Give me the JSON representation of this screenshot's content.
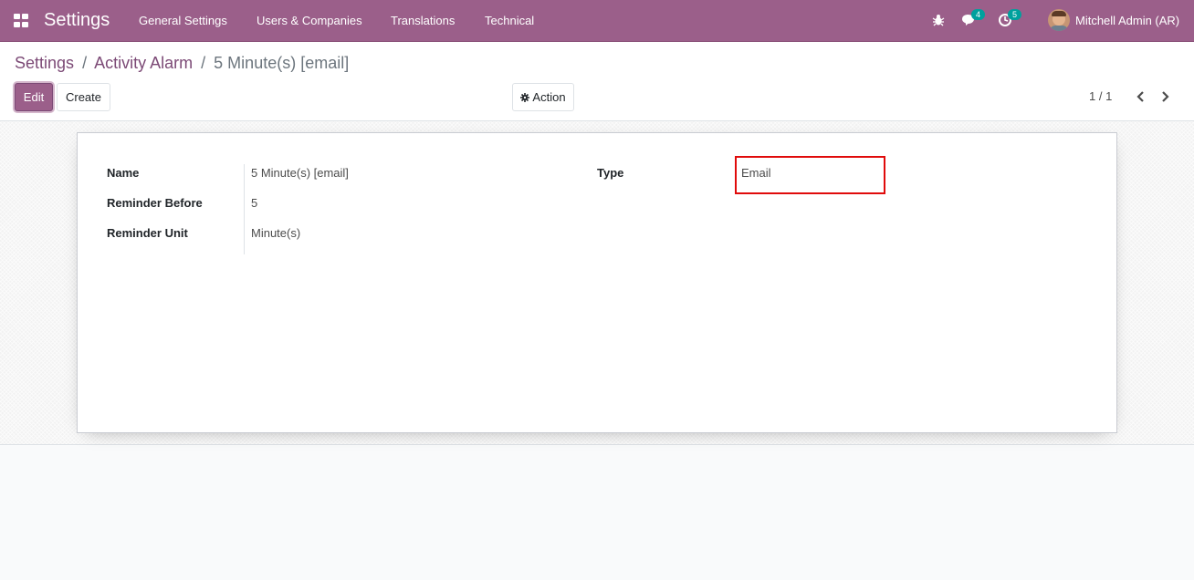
{
  "navbar": {
    "brand": "Settings",
    "menu": [
      "General Settings",
      "Users & Companies",
      "Translations",
      "Technical"
    ],
    "chat_count": "4",
    "activity_count": "5",
    "user_name": "Mitchell Admin (AR)"
  },
  "breadcrumb": {
    "level1": "Settings",
    "level2": "Activity Alarm",
    "current": "5 Minute(s) [email]",
    "separator": "/"
  },
  "buttons": {
    "edit": "Edit",
    "create": "Create",
    "action": "Action"
  },
  "pager": {
    "value": "1 / 1"
  },
  "form": {
    "name_label": "Name",
    "name_value": "5 Minute(s) [email]",
    "reminder_before_label": "Reminder Before",
    "reminder_before_value": "5",
    "reminder_unit_label": "Reminder Unit",
    "reminder_unit_value": "Minute(s)",
    "type_label": "Type",
    "type_value": "Email"
  },
  "colors": {
    "brand": "#9b5f8a",
    "badge": "#00a09d",
    "highlight": "#e00b0b"
  }
}
